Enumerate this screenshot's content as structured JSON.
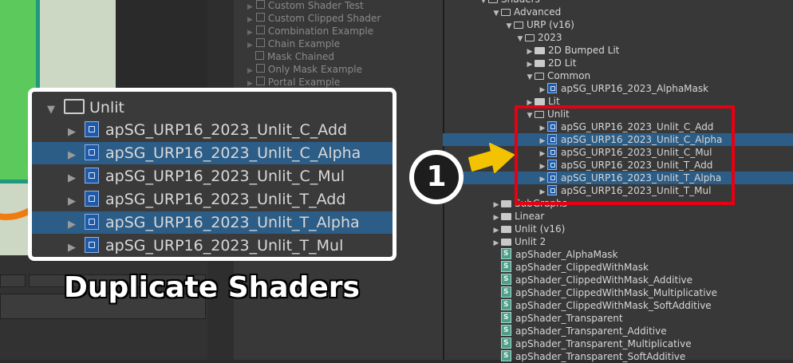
{
  "middle_panel": {
    "items": [
      {
        "label": "Custom Shader Test",
        "has_arrow": true
      },
      {
        "label": "Custom Clipped Shader",
        "has_arrow": true
      },
      {
        "label": "Combination Example",
        "has_arrow": true
      },
      {
        "label": "Chain Example",
        "has_arrow": true
      },
      {
        "label": "Mask Chained",
        "has_arrow": false
      },
      {
        "label": "Only Mask Example",
        "has_arrow": true
      },
      {
        "label": "Portal Example",
        "has_arrow": true
      }
    ]
  },
  "project_tree": {
    "rows": [
      {
        "label": "Shaders",
        "type": "folder-open"
      },
      {
        "label": "Advanced",
        "type": "folder-open"
      },
      {
        "label": "URP (v16)",
        "type": "folder-open"
      },
      {
        "label": "2023",
        "type": "folder-open"
      },
      {
        "label": "2D Bumped Lit",
        "type": "folder"
      },
      {
        "label": "2D Lit",
        "type": "folder"
      },
      {
        "label": "Common",
        "type": "folder-open"
      },
      {
        "label": "apSG_URP16_2023_AlphaMask",
        "type": "shadergraph"
      },
      {
        "label": "Lit",
        "type": "folder"
      },
      {
        "label": "Unlit",
        "type": "folder-open"
      },
      {
        "label": "apSG_URP16_2023_Unlit_C_Add",
        "type": "shadergraph"
      },
      {
        "label": "apSG_URP16_2023_Unlit_C_Alpha",
        "type": "shadergraph",
        "selected": true
      },
      {
        "label": "apSG_URP16_2023_Unlit_C_Mul",
        "type": "shadergraph"
      },
      {
        "label": "apSG_URP16_2023_Unlit_T_Add",
        "type": "shadergraph"
      },
      {
        "label": "apSG_URP16_2023_Unlit_T_Alpha",
        "type": "shadergraph",
        "selected": true
      },
      {
        "label": "apSG_URP16_2023_Unlit_T_Mul",
        "type": "shadergraph"
      },
      {
        "label": "SubGraphs",
        "type": "folder"
      },
      {
        "label": "Linear",
        "type": "folder"
      },
      {
        "label": "Unlit (v16)",
        "type": "folder"
      },
      {
        "label": "Unlit 2",
        "type": "folder"
      },
      {
        "label": "apShader_AlphaMask",
        "type": "shader"
      },
      {
        "label": "apShader_ClippedWithMask",
        "type": "shader"
      },
      {
        "label": "apShader_ClippedWithMask_Additive",
        "type": "shader"
      },
      {
        "label": "apShader_ClippedWithMask_Multiplicative",
        "type": "shader"
      },
      {
        "label": "apShader_ClippedWithMask_SoftAdditive",
        "type": "shader"
      },
      {
        "label": "apShader_Transparent",
        "type": "shader"
      },
      {
        "label": "apShader_Transparent_Additive",
        "type": "shader"
      },
      {
        "label": "apShader_Transparent_Multiplicative",
        "type": "shader"
      },
      {
        "label": "apShader_Transparent_SoftAdditive",
        "type": "shader"
      }
    ]
  },
  "callout": {
    "folder_label": "Unlit",
    "items": [
      {
        "label": "apSG_URP16_2023_Unlit_C_Add",
        "selected": false
      },
      {
        "label": "apSG_URP16_2023_Unlit_C_Alpha",
        "selected": true
      },
      {
        "label": "apSG_URP16_2023_Unlit_C_Mul",
        "selected": false
      },
      {
        "label": "apSG_URP16_2023_Unlit_T_Add",
        "selected": false
      },
      {
        "label": "apSG_URP16_2023_Unlit_T_Alpha",
        "selected": true
      },
      {
        "label": "apSG_URP16_2023_Unlit_T_Mul",
        "selected": false
      }
    ]
  },
  "caption": "Duplicate Shaders",
  "step_number": "1",
  "colors": {
    "selection": "#2c5d87",
    "highlight_box": "#e60012",
    "arrow": "#f3c200"
  }
}
